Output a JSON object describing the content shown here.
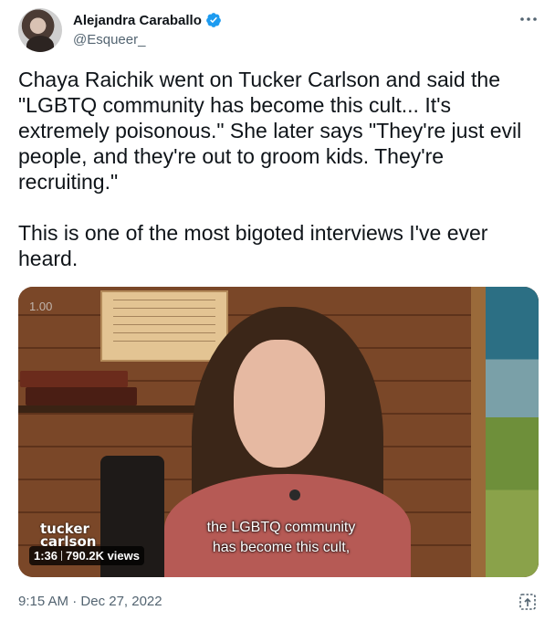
{
  "author": {
    "display_name": "Alejandra Caraballo",
    "handle": "@Esqueer_",
    "verified": true
  },
  "tweet": {
    "text": "Chaya Raichik went on Tucker Carlson and said the \"LGBTQ community has become this cult... It's extremely poisonous.\" She later says \"They're just evil people, and they're out to groom kids. They're recruiting.\"\n\nThis is one of the most bigoted interviews I've ever heard.",
    "time": "9:15 AM",
    "separator": "·",
    "date": "Dec 27, 2022"
  },
  "media": {
    "speed": "1.00",
    "logo_line1": "tucker",
    "logo_line2": "carlson",
    "duration": "1:36",
    "views": "790.2K views",
    "caption_line1": "the LGBTQ community",
    "caption_line2": "has become this cult,"
  },
  "icons": {
    "verified": "verified-badge-icon",
    "more": "more-icon",
    "share": "share-icon"
  },
  "colors": {
    "verified_blue": "#1d9bf0",
    "secondary_text": "#536471",
    "primary_text": "#0f1419"
  }
}
